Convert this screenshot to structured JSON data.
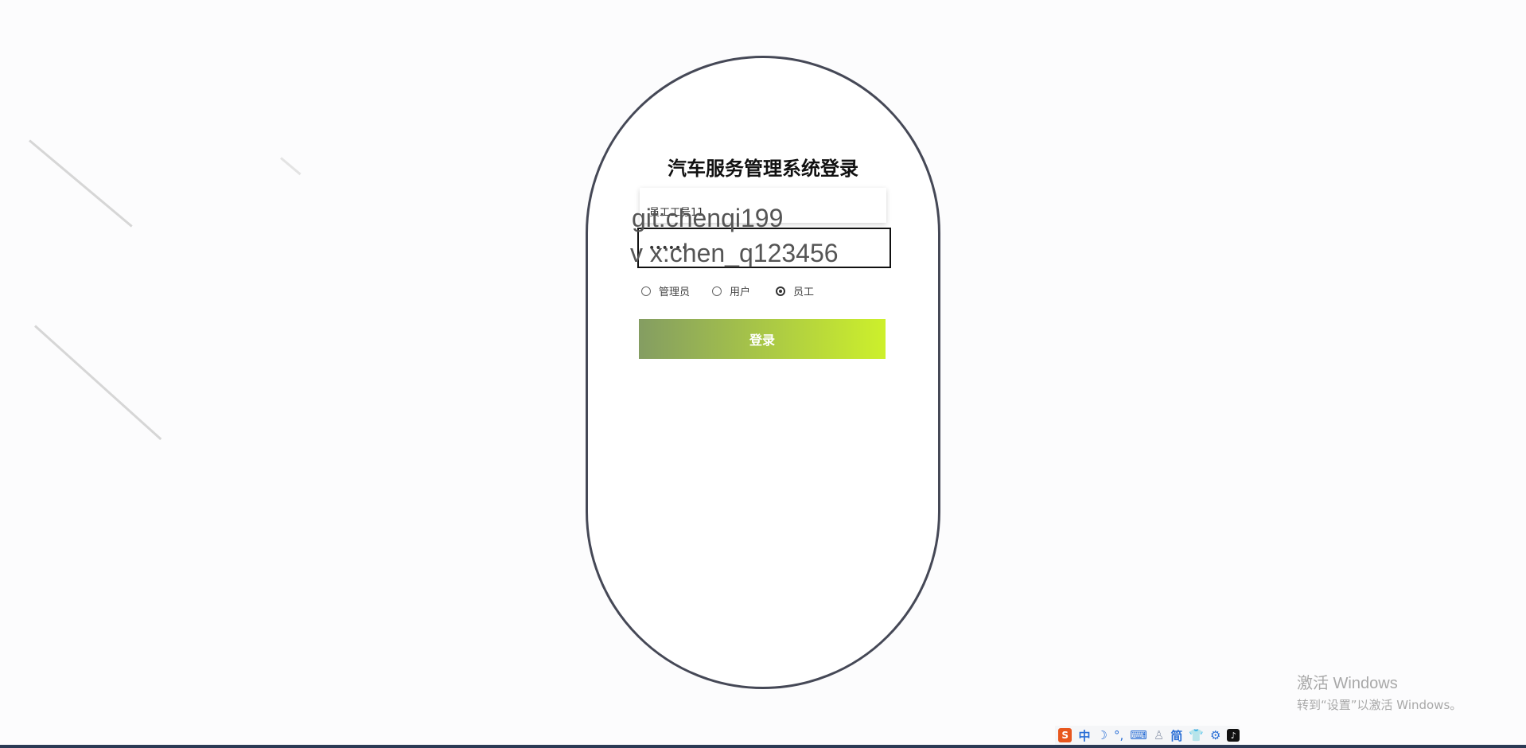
{
  "page": {
    "title": "汽车服务管理系统登录"
  },
  "form": {
    "username_value": "员工工号11",
    "password_value": "......",
    "roles": [
      {
        "label": "管理员",
        "checked": false
      },
      {
        "label": "用户",
        "checked": false
      },
      {
        "label": "员工",
        "checked": true
      }
    ],
    "login_label": "登录"
  },
  "overlay": {
    "line1": "git:chenqi199",
    "line2": "v x:chen_q123456"
  },
  "watermark": {
    "title": "激活 Windows",
    "subtitle": "转到“设置”以激活 Windows。"
  },
  "ime": {
    "items": [
      "中",
      "简"
    ]
  },
  "colors": {
    "card_border": "#454856",
    "button_gradient_start": "#849d62",
    "button_gradient_end": "#cdf02b",
    "background": "#fcfcfd"
  }
}
